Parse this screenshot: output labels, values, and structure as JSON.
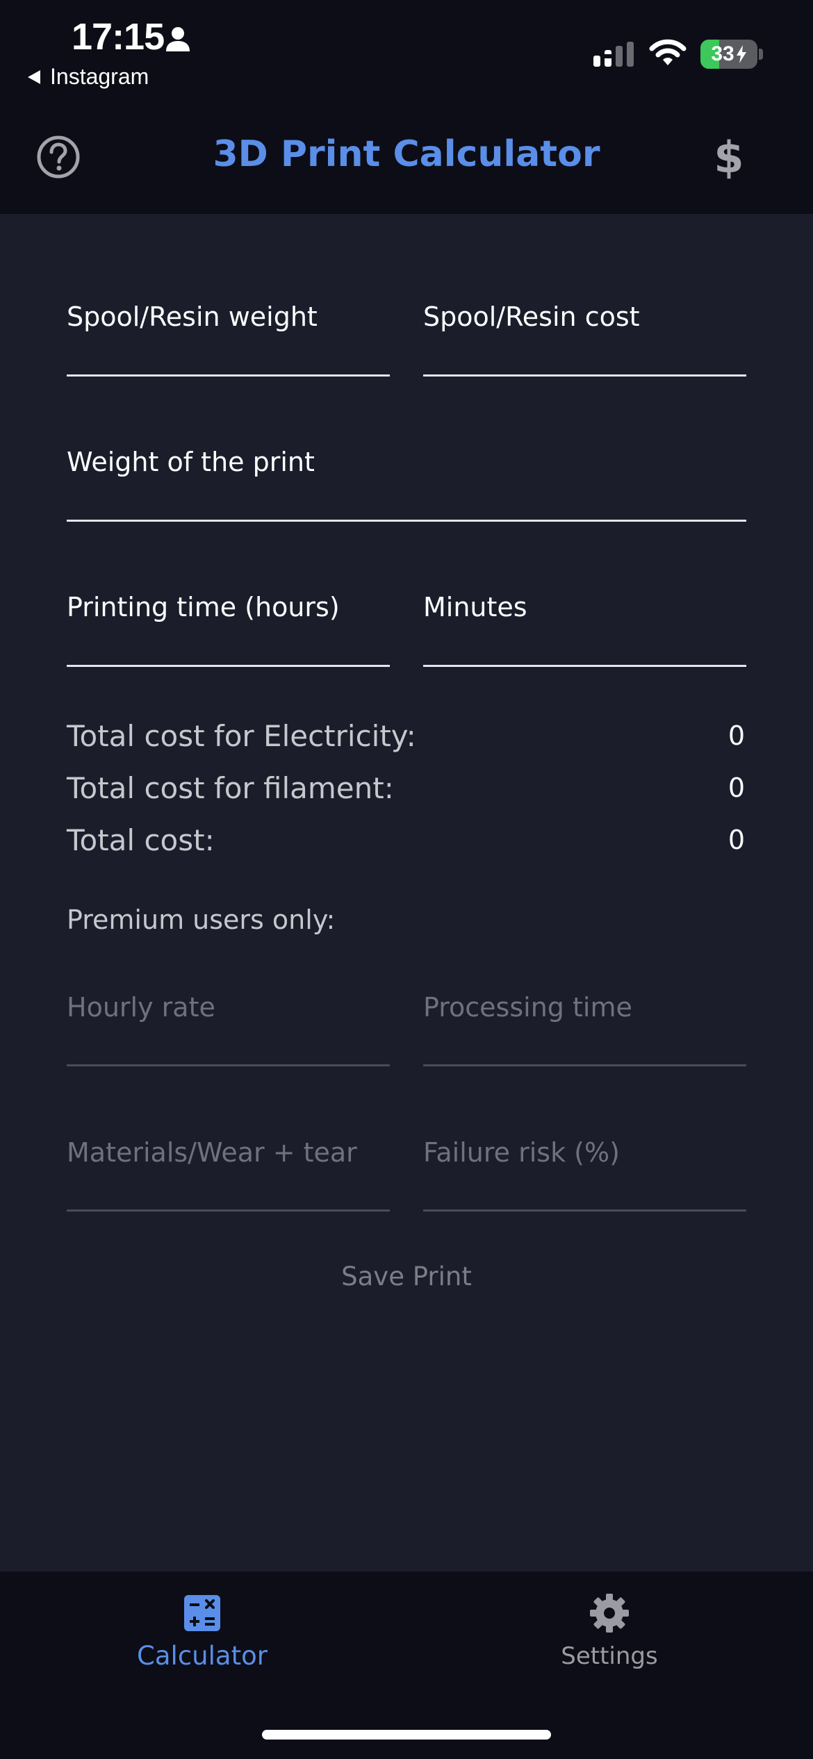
{
  "status_bar": {
    "time": "17:15",
    "back_app": "Instagram",
    "battery_level": "33",
    "battery_percent": 33,
    "battery_color": "#3cc85a"
  },
  "header": {
    "title": "3D Print Calculator",
    "help_icon": "question-circle-icon",
    "currency_icon": "dollar-icon",
    "title_color": "#5a8ee8"
  },
  "form": {
    "spool_weight_label": "Spool/Resin weight",
    "spool_cost_label": "Spool/Resin cost",
    "print_weight_label": "Weight of the print",
    "print_hours_label": "Printing time (hours)",
    "print_minutes_label": "Minutes"
  },
  "results": {
    "electricity_label": "Total cost for Electricity:",
    "electricity_value": "0",
    "filament_label": "Total cost for filament:",
    "filament_value": "0",
    "total_label": "Total cost:",
    "total_value": "0"
  },
  "premium": {
    "section_label": "Premium users only:",
    "hourly_rate_label": "Hourly rate",
    "processing_time_label": "Processing time",
    "materials_label": "Materials/Wear + tear",
    "failure_risk_label": "Failure risk (%)",
    "save_label": "Save Print"
  },
  "tabbar": {
    "calculator_label": "Calculator",
    "settings_label": "Settings",
    "calculator_icon": "calculator-icon",
    "settings_icon": "gear-icon",
    "active_color": "#5a8ee8"
  }
}
